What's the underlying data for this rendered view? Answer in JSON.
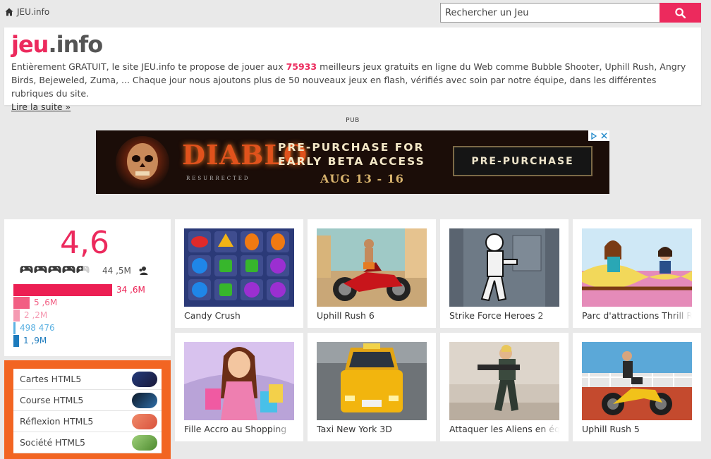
{
  "breadcrumb": {
    "home_label": "JEU.info"
  },
  "search": {
    "placeholder": "Rechercher un Jeu"
  },
  "intro": {
    "logo_part1": "jeu",
    "logo_part2": ".info",
    "text_before": "Entièrement GRATUIT, le site JEU.info te propose de jouer aux ",
    "game_count": "75933",
    "text_after": " meilleurs jeux gratuits en ligne du Web comme Bubble Shooter, Uphill Rush, Angry Birds, Bejeweled, Zuma, ... Chaque jour nous ajoutons plus de 50 nouveaux jeux en flash, vérifiés avec soin par notre équipe, dans les différentes rubriques du site.",
    "read_more": "Lire la suite »"
  },
  "ad": {
    "label": "PUB",
    "logo": "DIABLO",
    "logo_sub": "RESURRECTED",
    "headline_line1": "PRE-PURCHASE FOR",
    "headline_line2": "EARLY BETA ACCESS",
    "date": "AUG 13 - 16",
    "cta": "PRE-PURCHASE"
  },
  "rating": {
    "score": "4,6",
    "controllers_filled": 4.5,
    "votes": "44 ,5M",
    "bars": [
      {
        "label": "34 ,6M",
        "color": "#ec1f53",
        "share": 0.779
      },
      {
        "label": "5 ,6M",
        "color": "#f25e83",
        "share": 0.126
      },
      {
        "label": "2 ,2M",
        "color": "#f59ab2",
        "share": 0.05
      },
      {
        "label": "498 476",
        "color": "#5bb1e2",
        "share": 0.011
      },
      {
        "label": "1 ,9M",
        "color": "#1d7bbd",
        "share": 0.043
      }
    ]
  },
  "categories": [
    {
      "label": "Cartes HTML5"
    },
    {
      "label": "Course HTML5"
    },
    {
      "label": "Réflexion HTML5"
    },
    {
      "label": "Société HTML5"
    }
  ],
  "games": [
    {
      "title": "Candy Crush"
    },
    {
      "title": "Uphill Rush 6"
    },
    {
      "title": "Strike Force Heroes 2"
    },
    {
      "title": "Parc d'attractions Thrill R"
    },
    {
      "title": "Fille Accro au Shopping"
    },
    {
      "title": "Taxi New York 3D"
    },
    {
      "title": "Attaquer les Aliens en éq"
    },
    {
      "title": "Uphill Rush 5"
    }
  ]
}
